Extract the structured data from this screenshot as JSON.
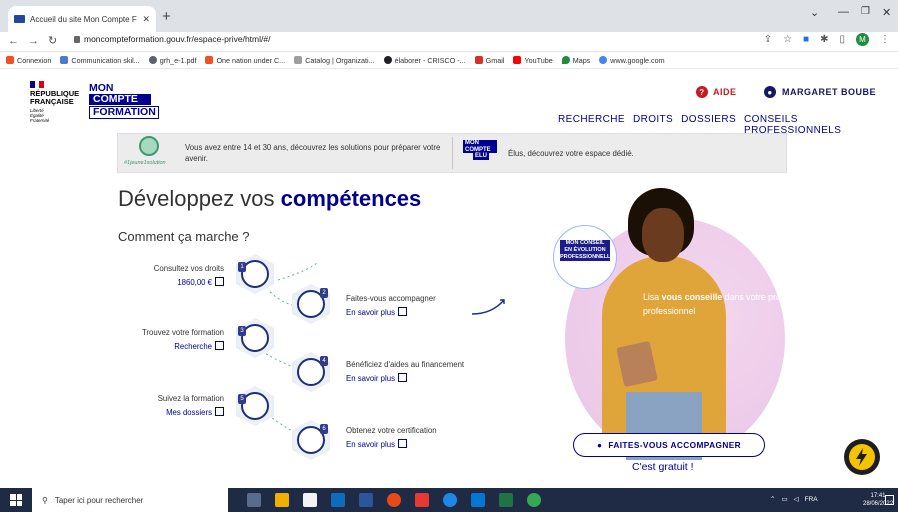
{
  "browser": {
    "tab_title": "Accueil du site Mon Compte For",
    "url": "moncompteformation.gouv.fr/espace-prive/html/#/",
    "profile_initial": "M",
    "bookmarks": [
      {
        "label": "Connexion",
        "color": "#f25022"
      },
      {
        "label": "Communication skil...",
        "color": "#4a7bd0"
      },
      {
        "label": "grh_e-1.pdf",
        "color": "#5f6368"
      },
      {
        "label": "One nation under C...",
        "color": "#f25022"
      },
      {
        "label": "Catalog | Organizati...",
        "color": "#9e9e9e"
      },
      {
        "label": "élaborer - CRISCO -...",
        "color": "#202124"
      },
      {
        "label": "Gmail",
        "color": "#d93025"
      },
      {
        "label": "YouTube",
        "color": "#ff0000"
      },
      {
        "label": "Maps",
        "color": "#1e8e3e"
      },
      {
        "label": "www.google.com",
        "color": "#4285f4"
      }
    ]
  },
  "site": {
    "republique": [
      "RÉPUBLIQUE",
      "FRANÇAISE"
    ],
    "devise": [
      "Liberté",
      "Égalité",
      "Fraternité"
    ],
    "logo": [
      "MON",
      "COMPTE",
      "FORMATION"
    ],
    "aide": "AIDE",
    "user_name": "MARGARET BOUBE",
    "nav": [
      "RECHERCHE",
      "DROITS",
      "DOSSIERS",
      "CONSEILS PROFESSIONNELS"
    ],
    "banner": {
      "jeune_tag": "#1jeune1solution",
      "jeune_text": "Vous avez entre 14 et 30 ans, découvrez les solutions pour préparer votre avenir.",
      "elu_logo": [
        "MON",
        "COMPTE",
        "ELU"
      ],
      "elu_text": "Élus, découvrez votre espace dédié."
    },
    "hero": {
      "title_prefix": "Développez vos ",
      "title_bold": "compétences",
      "subtitle": "Comment ça marche ?"
    },
    "steps": [
      {
        "num": "1",
        "text": "Consultez vos droits",
        "link": "1860,00 €"
      },
      {
        "num": "2",
        "text": "Faites-vous accompagner",
        "link": "En savoir plus"
      },
      {
        "num": "3",
        "text": "Trouvez votre formation",
        "link": "Recherche"
      },
      {
        "num": "4",
        "text": "Bénéficiez d'aides au financement",
        "link": "En savoir plus"
      },
      {
        "num": "5",
        "text": "Suivez la formation",
        "link": "Mes dossiers"
      },
      {
        "num": "6",
        "text": "Obtenez votre certification",
        "link": "En savoir plus"
      }
    ],
    "conseil_logo": [
      "MON CONSEIL",
      "EN ÉVOLUTION",
      "PROFESSIONNELLE"
    ],
    "lisa_prefix": "Lisa ",
    "lisa_bold": "vous conseille",
    "lisa_suffix": " dans votre projet professionnel",
    "cta": "FAITES-VOUS ACCOMPAGNER",
    "free": "C'est gratuit !"
  },
  "taskbar": {
    "search_placeholder": "Taper ici pour rechercher",
    "lang": "FRA",
    "time": "17:41",
    "date": "28/06/2022"
  },
  "colors": {
    "brand_blue": "#000091",
    "marianne_red": "#c9191e",
    "taskbar": "#1f2b44"
  }
}
